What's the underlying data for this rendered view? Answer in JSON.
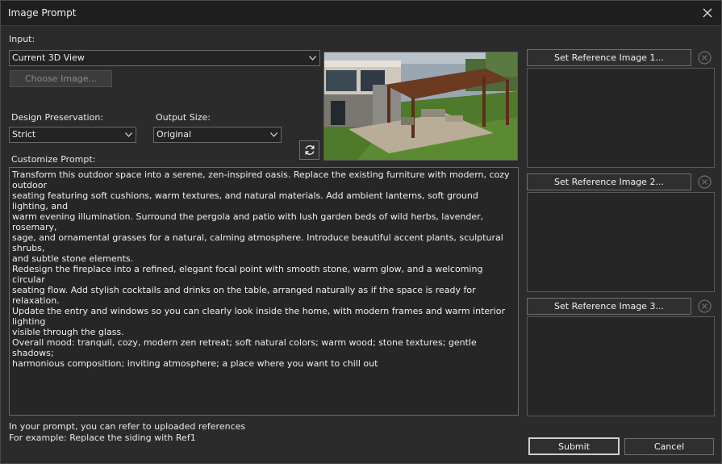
{
  "window": {
    "title": "Image Prompt"
  },
  "input": {
    "label": "Input:",
    "selected": "Current 3D View",
    "choose_image_label": "Choose Image..."
  },
  "design_preservation": {
    "label": "Design Preservation:",
    "selected": "Strict"
  },
  "output_size": {
    "label": "Output Size:",
    "selected": "Original"
  },
  "prompt": {
    "label": "Customize Prompt:",
    "text": "Transform this outdoor space into a serene, zen-inspired oasis. Replace the existing furniture with modern, cozy outdoor\nseating featuring soft cushions, warm textures, and natural materials. Add ambient lanterns, soft ground lighting, and\nwarm evening illumination. Surround the pergola and patio with lush garden beds of wild herbs, lavender, rosemary,\nsage, and ornamental grasses for a natural, calming atmosphere. Introduce beautiful accent plants, sculptural shrubs,\nand subtle stone elements.\nRedesign the fireplace into a refined, elegant focal point with smooth stone, warm glow, and a welcoming circular\nseating flow. Add stylish cocktails and drinks on the table, arranged naturally as if the space is ready for relaxation.\nUpdate the entry and windows so you can clearly look inside the home, with modern frames and warm interior lighting\nvisible through the glass.\nOverall mood: tranquil, cozy, modern zen retreat; soft natural colors; warm wood; stone textures; gentle shadows;\nharmonious composition; inviting atmosphere; a place where you want to chill out"
  },
  "hint": {
    "line1": "In your prompt, you can refer to uploaded references",
    "line2": "For example: Replace the siding with Ref1"
  },
  "references": [
    {
      "button_label": "Set Reference Image 1..."
    },
    {
      "button_label": "Set Reference Image 2..."
    },
    {
      "button_label": "Set Reference Image 3..."
    }
  ],
  "actions": {
    "submit_label": "Submit",
    "cancel_label": "Cancel"
  },
  "icons": {
    "close": "close-icon",
    "refresh": "refresh-icon",
    "clear_reference": "clear-circle-icon",
    "dropdown": "chevron-down-icon"
  },
  "colors": {
    "background": "#2b2b2b",
    "titlebar": "#1f1f1f",
    "field": "#262626",
    "text": "#e6e6e6"
  }
}
